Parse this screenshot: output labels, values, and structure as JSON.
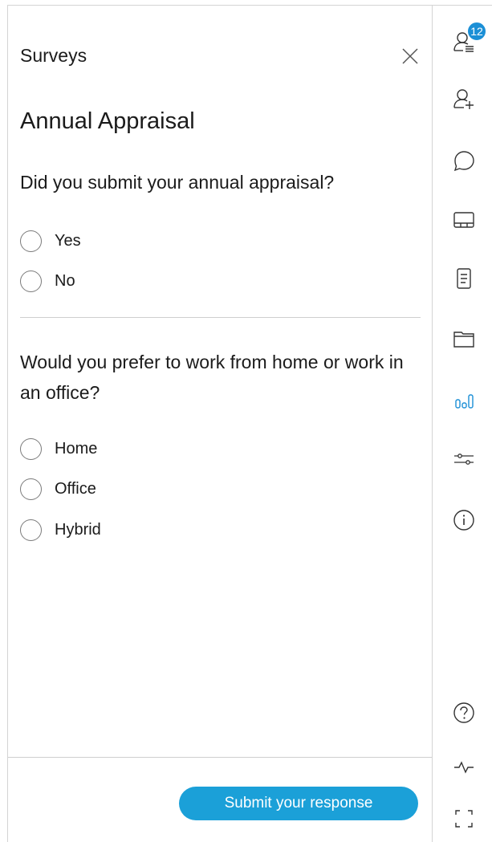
{
  "panel": {
    "title": "Surveys",
    "survey_title": "Annual Appraisal",
    "questions": [
      {
        "text": "Did you submit your annual appraisal?",
        "options": [
          "Yes",
          "No"
        ]
      },
      {
        "text": "Would you prefer to work from home or work in an office?",
        "options": [
          "Home",
          "Office",
          "Hybrid"
        ]
      }
    ],
    "submit_label": "Submit your response"
  },
  "rail": {
    "participants_badge": "12",
    "icons": [
      "participants-list-icon",
      "add-participant-icon",
      "chat-icon",
      "layout-icon",
      "notes-icon",
      "files-icon",
      "polls-icon",
      "settings-sliders-icon",
      "info-icon",
      "help-icon",
      "network-activity-icon",
      "fullscreen-icon"
    ],
    "accent_color": "#1ba0d8"
  },
  "colors": {
    "button": "#1ba0d8",
    "badge": "#1b8fd6",
    "active_icon": "#1b8fd6"
  }
}
